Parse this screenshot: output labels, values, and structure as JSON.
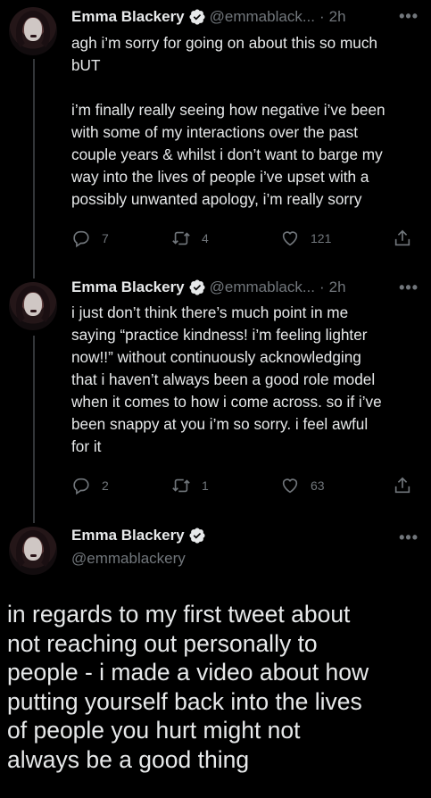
{
  "colors": {
    "background": "#000000",
    "text": "#e7e9ea",
    "muted": "#71767b",
    "verified": "#e7e9ea"
  },
  "tweets": [
    {
      "name": "Emma Blackery",
      "handle": "@emmablack...",
      "dot": "·",
      "time": "2h",
      "more": "•••",
      "text": "agh i’m sorry for going on about this so much\nbUT\n\ni’m finally really seeing how negative i’ve been\nwith some of my interactions over the past\ncouple years & whilst i don’t want to barge my\nway into the lives of people i’ve upset with a\npossibly unwanted apology, i’m really sorry",
      "replies": "7",
      "retweets": "4",
      "likes": "121"
    },
    {
      "name": "Emma Blackery",
      "handle": "@emmablack...",
      "dot": "·",
      "time": "2h",
      "more": "•••",
      "text": "i just don’t think there’s much point in me\nsaying “practice kindness! i’m feeling lighter\nnow!!” without continuously acknowledging\nthat i haven’t always been a good role model\nwhen it comes to how i come across. so if i’ve\nbeen snappy at you i’m so sorry. i feel awful\nfor it",
      "replies": "2",
      "retweets": "1",
      "likes": "63"
    }
  ],
  "main_tweet": {
    "name": "Emma Blackery",
    "handle": "@emmablackery",
    "more": "•••",
    "text": "in regards to my first tweet about\nnot reaching out personally to\npeople - i made a video about how\nputting yourself back into the lives\nof people you hurt might not\nalways be a good thing"
  },
  "icons": {
    "reply": "reply-icon",
    "retweet": "retweet-icon",
    "like": "heart-icon",
    "share": "share-icon",
    "verified": "verified-badge-icon"
  }
}
